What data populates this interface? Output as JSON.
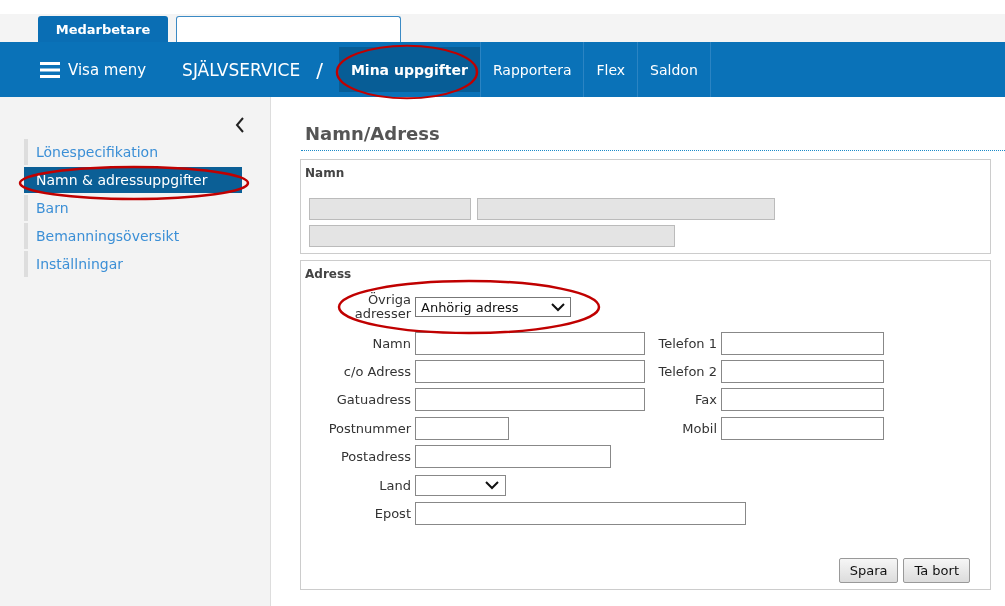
{
  "tabs": [
    {
      "label": "Medarbetare",
      "selected": true
    },
    {
      "selected": false
    }
  ],
  "topbar": {
    "menu_label": "Visa meny",
    "section": "SJÄLVSERVICE",
    "separator": "/",
    "items": [
      {
        "label": "Mina uppgifter",
        "selected": true,
        "circled": true
      },
      {
        "label": "Rapportera",
        "selected": false,
        "circled": false
      },
      {
        "label": "Flex",
        "selected": false,
        "circled": false
      },
      {
        "label": "Saldon",
        "selected": false,
        "circled": false
      }
    ]
  },
  "sidebar": {
    "items": [
      {
        "label": "Lönespecifikation",
        "selected": false,
        "circled": false
      },
      {
        "label": "Namn & adressuppgifter",
        "selected": true,
        "circled": true
      },
      {
        "label": "Barn",
        "selected": false,
        "circled": false
      },
      {
        "label": "Bemanningsöversikt",
        "selected": false,
        "circled": false
      },
      {
        "label": "Inställningar",
        "selected": false,
        "circled": false
      }
    ]
  },
  "page_title": "Namn/Adress",
  "name_section": {
    "title": "Namn",
    "fields": [
      {
        "disabled": true
      },
      {
        "disabled": true
      },
      {
        "disabled": true
      }
    ]
  },
  "address_section": {
    "title": "Adress",
    "other_addresses": {
      "label": "Övriga adresser",
      "value": "Anhörig adress",
      "circled": true
    },
    "left_fields": [
      {
        "label": "Namn",
        "kind": "text"
      },
      {
        "label": "c/o Adress",
        "kind": "text"
      },
      {
        "label": "Gatuadress",
        "kind": "text"
      },
      {
        "label": "Postnummer",
        "kind": "text"
      },
      {
        "label": "Postadress",
        "kind": "text"
      },
      {
        "label": "Land",
        "kind": "select"
      },
      {
        "label": "Epost",
        "kind": "text"
      }
    ],
    "right_fields": [
      {
        "label": "Telefon 1",
        "kind": "text"
      },
      {
        "label": "Telefon 2",
        "kind": "text"
      },
      {
        "label": "Fax",
        "kind": "text"
      },
      {
        "label": "Mobil",
        "kind": "text"
      }
    ],
    "buttons": [
      "Spara",
      "Ta bort"
    ]
  }
}
